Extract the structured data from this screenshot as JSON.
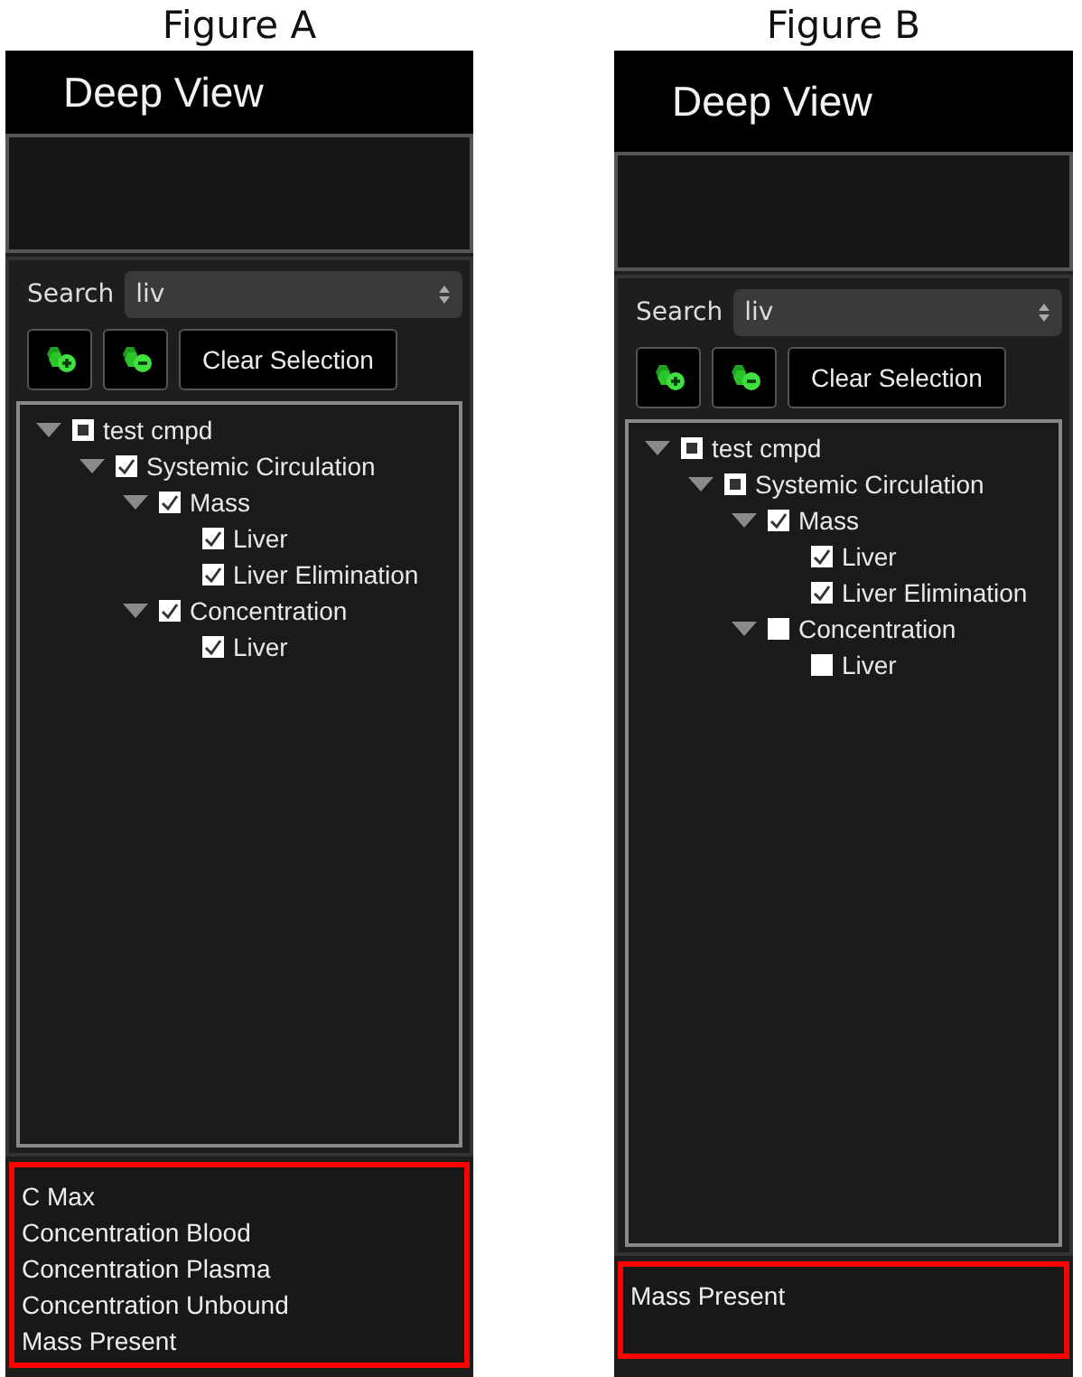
{
  "figures": [
    {
      "caption": "Figure A",
      "title": "Deep View",
      "search": {
        "label": "Search",
        "value": "liv"
      },
      "clear_button": "Clear Selection",
      "tree": [
        {
          "label": "test cmpd",
          "checked": false,
          "partial": true,
          "expanded": true,
          "children": [
            {
              "label": "Systemic Circulation",
              "checked": true,
              "partial": false,
              "expanded": true,
              "children": [
                {
                  "label": "Mass",
                  "checked": true,
                  "partial": false,
                  "expanded": true,
                  "children": [
                    {
                      "label": "Liver",
                      "checked": true,
                      "partial": false
                    },
                    {
                      "label": "Liver Elimination",
                      "checked": true,
                      "partial": false
                    }
                  ]
                },
                {
                  "label": "Concentration",
                  "checked": true,
                  "partial": false,
                  "expanded": true,
                  "children": [
                    {
                      "label": "Liver",
                      "checked": true,
                      "partial": false
                    }
                  ]
                }
              ]
            }
          ]
        }
      ],
      "results": [
        "C Max",
        "Concentration Blood",
        "Concentration Plasma",
        "Concentration Unbound",
        "Mass Present"
      ]
    },
    {
      "caption": "Figure B",
      "title": "Deep View",
      "search": {
        "label": "Search",
        "value": "liv"
      },
      "clear_button": "Clear Selection",
      "tree": [
        {
          "label": "test cmpd",
          "checked": false,
          "partial": true,
          "expanded": true,
          "children": [
            {
              "label": "Systemic Circulation",
              "checked": false,
              "partial": true,
              "expanded": true,
              "children": [
                {
                  "label": "Mass",
                  "checked": true,
                  "partial": false,
                  "expanded": true,
                  "children": [
                    {
                      "label": "Liver",
                      "checked": true,
                      "partial": false
                    },
                    {
                      "label": "Liver Elimination",
                      "checked": true,
                      "partial": false
                    }
                  ]
                },
                {
                  "label": "Concentration",
                  "checked": false,
                  "partial": false,
                  "expanded": true,
                  "children": [
                    {
                      "label": "Liver",
                      "checked": false,
                      "partial": false
                    }
                  ]
                }
              ]
            }
          ]
        }
      ],
      "results": [
        "Mass Present"
      ]
    }
  ]
}
